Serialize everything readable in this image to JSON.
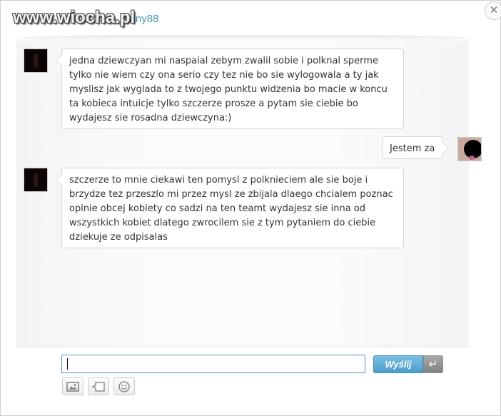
{
  "header": {
    "watermark": "www.wiocha.pl",
    "username_visible": "vany88"
  },
  "messages": [
    {
      "side": "left",
      "text": "jedna dziewczyan mi naspaial zebym zwalil sobie i polknal sperme tylko nie wiem czy ona serio czy tez nie bo sie wylogowala a ty jak myslisz jak wyglada to z twojego punktu widzenia bo macie w koncu ta kobieca intuicje tylko szczerze prosze a pytam sie ciebie bo wydajesz sie rosadna dziewczyna:)"
    },
    {
      "side": "right",
      "text": "Jestem za"
    },
    {
      "side": "left",
      "text": "szczerze to mnie ciekawi ten pomysl z polknieciem ale sie boje i brzydze tez przeszlo mi przez mysl ze zbijala dlaego chcialem poznac opinie obcej kobiety co sadzi na ten teamt wydajesz sie inna od wszystkich kobiet dlatego zwrocilem sie z tym pytaniem do ciebie dziekuje ze odpisalas"
    }
  ],
  "composer": {
    "input_value": "",
    "send_label": "Wyślij",
    "enter_icon": "enter-arrow-icon",
    "tools": [
      "image-icon",
      "speech-bubble-icon",
      "smiley-icon"
    ],
    "close_icon": "close-icon"
  }
}
